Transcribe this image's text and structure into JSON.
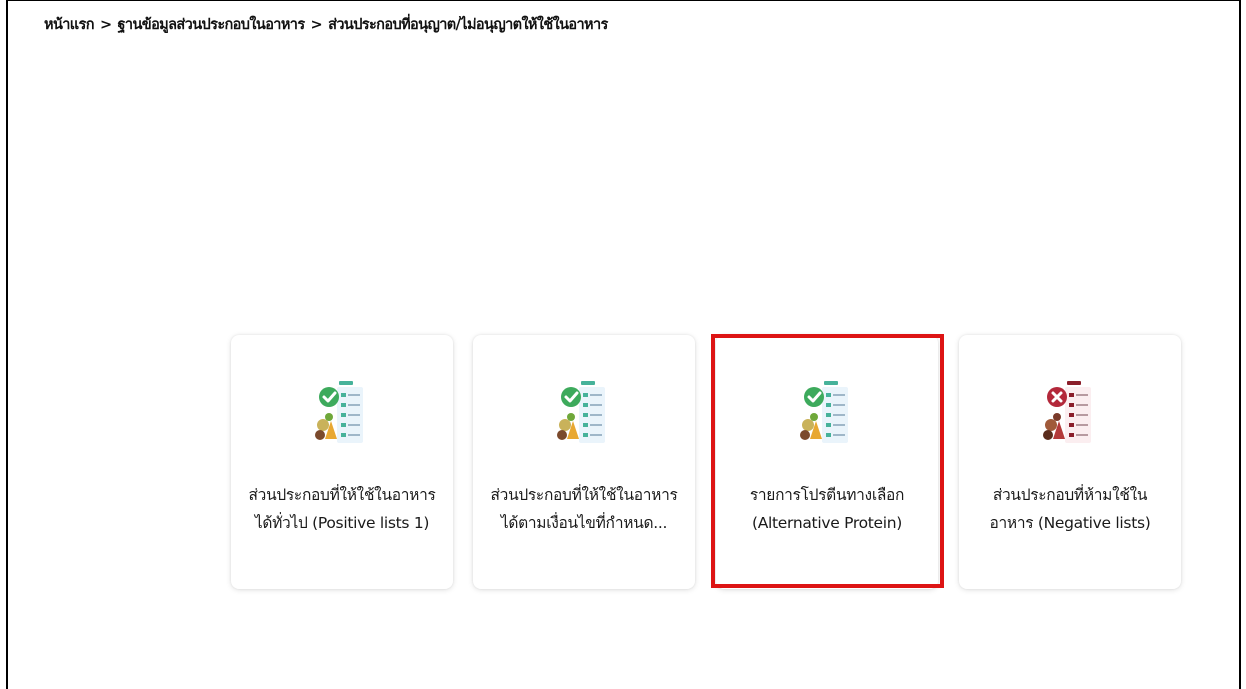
{
  "breadcrumb": {
    "items": [
      "หน้าแรก",
      "ฐานข้อมูลส่วนประกอบในอาหาร",
      "ส่วนประกอบที่อนุญาต/ไม่อนุญาตให้ใช้ในอาหาร"
    ],
    "separator": ">"
  },
  "cards": [
    {
      "line1": "ส่วนประกอบที่ให้ใช้ในอาหาร",
      "line2": "ได้ทั่วไป (Positive lists 1)",
      "icon": "positive-list-icon",
      "accent": "#46b29a"
    },
    {
      "line1": "ส่วนประกอบที่ให้ใช้ในอาหาร",
      "line2": "ได้ตามเงื่อนไขที่กำหนด...",
      "icon": "positive-list-icon",
      "accent": "#46b29a"
    },
    {
      "line1": "รายการโปรตีนทางเลือก",
      "line2": "(Alternative Protein)",
      "icon": "positive-list-icon",
      "accent": "#46b29a"
    },
    {
      "line1": "ส่วนประกอบที่ห้ามใช้ใน",
      "line2": "อาหาร (Negative lists)",
      "icon": "negative-list-icon",
      "accent": "#8b1e2a"
    }
  ],
  "highlight": {
    "color": "#dd1414",
    "target_card": 2
  }
}
